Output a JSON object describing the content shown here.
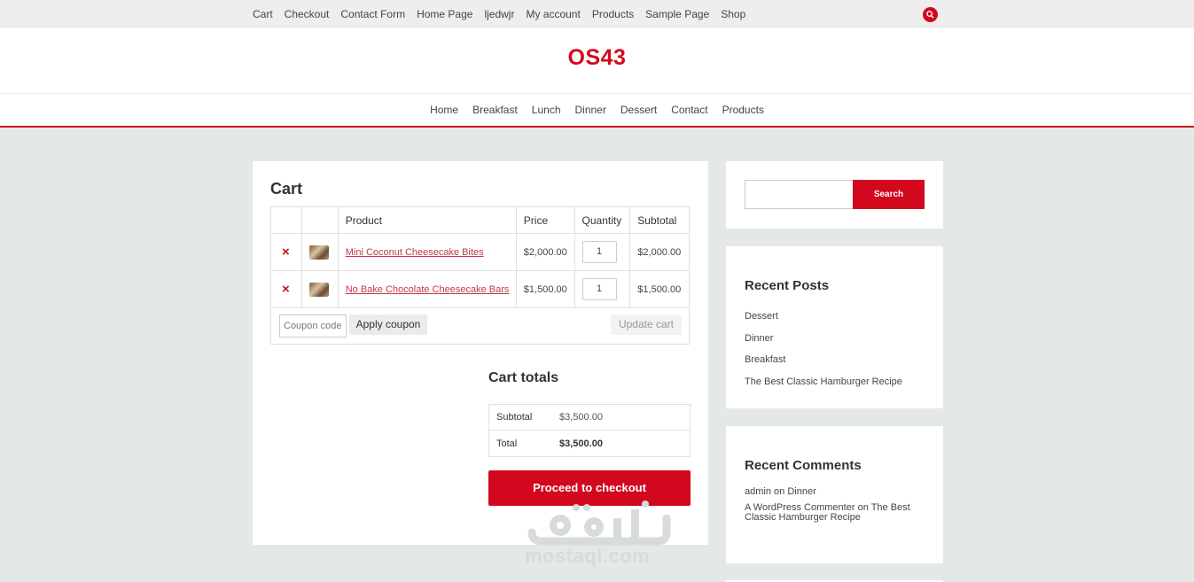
{
  "topbar": {
    "links": [
      "Cart",
      "Checkout",
      "Contact Form",
      "Home Page",
      "ljedwjr",
      "My account",
      "Products",
      "Sample Page",
      "Shop"
    ],
    "search_icon": "search-icon"
  },
  "site": {
    "title": "OS43"
  },
  "mainnav": {
    "items": [
      "Home",
      "Breakfast",
      "Lunch",
      "Dinner",
      "Dessert",
      "Contact",
      "Products"
    ]
  },
  "cart": {
    "title": "Cart",
    "columns": [
      "",
      "",
      "Product",
      "Price",
      "Quantity",
      "Subtotal"
    ],
    "items": [
      {
        "remove": "×",
        "name": "Mini Coconut Cheesecake Bites",
        "price": "$2,000.00",
        "quantity": "1",
        "subtotal": "$2,000.00"
      },
      {
        "remove": "×",
        "name": "No Bake Chocolate Cheesecake Bars",
        "price": "$1,500.00",
        "quantity": "1",
        "subtotal": "$1,500.00"
      }
    ],
    "coupon_placeholder": "Coupon code",
    "apply_coupon": "Apply coupon",
    "update_cart": "Update cart"
  },
  "totals": {
    "title": "Cart totals",
    "subtotal_label": "Subtotal",
    "subtotal_value": "$3,500.00",
    "total_label": "Total",
    "total_value": "$3,500.00",
    "checkout": "Proceed to checkout"
  },
  "watermark": {
    "arabic": "مستقل",
    "latin": "mostaql.com"
  },
  "sidebar": {
    "search_button": "Search",
    "recent_posts_title": "Recent Posts",
    "recent_posts": [
      "Dessert",
      "Dinner",
      "Breakfast",
      "The Best Classic Hamburger Recipe"
    ],
    "recent_comments_title": "Recent Comments",
    "recent_comments": [
      {
        "author": "admin",
        "on": "on",
        "post": "Dinner"
      },
      {
        "author": "A WordPress Commenter",
        "on": "on",
        "post": "The Best Classic Hamburger Recipe"
      }
    ]
  },
  "colors": {
    "accent": "#d2081f",
    "background": "#e4e8e6"
  }
}
